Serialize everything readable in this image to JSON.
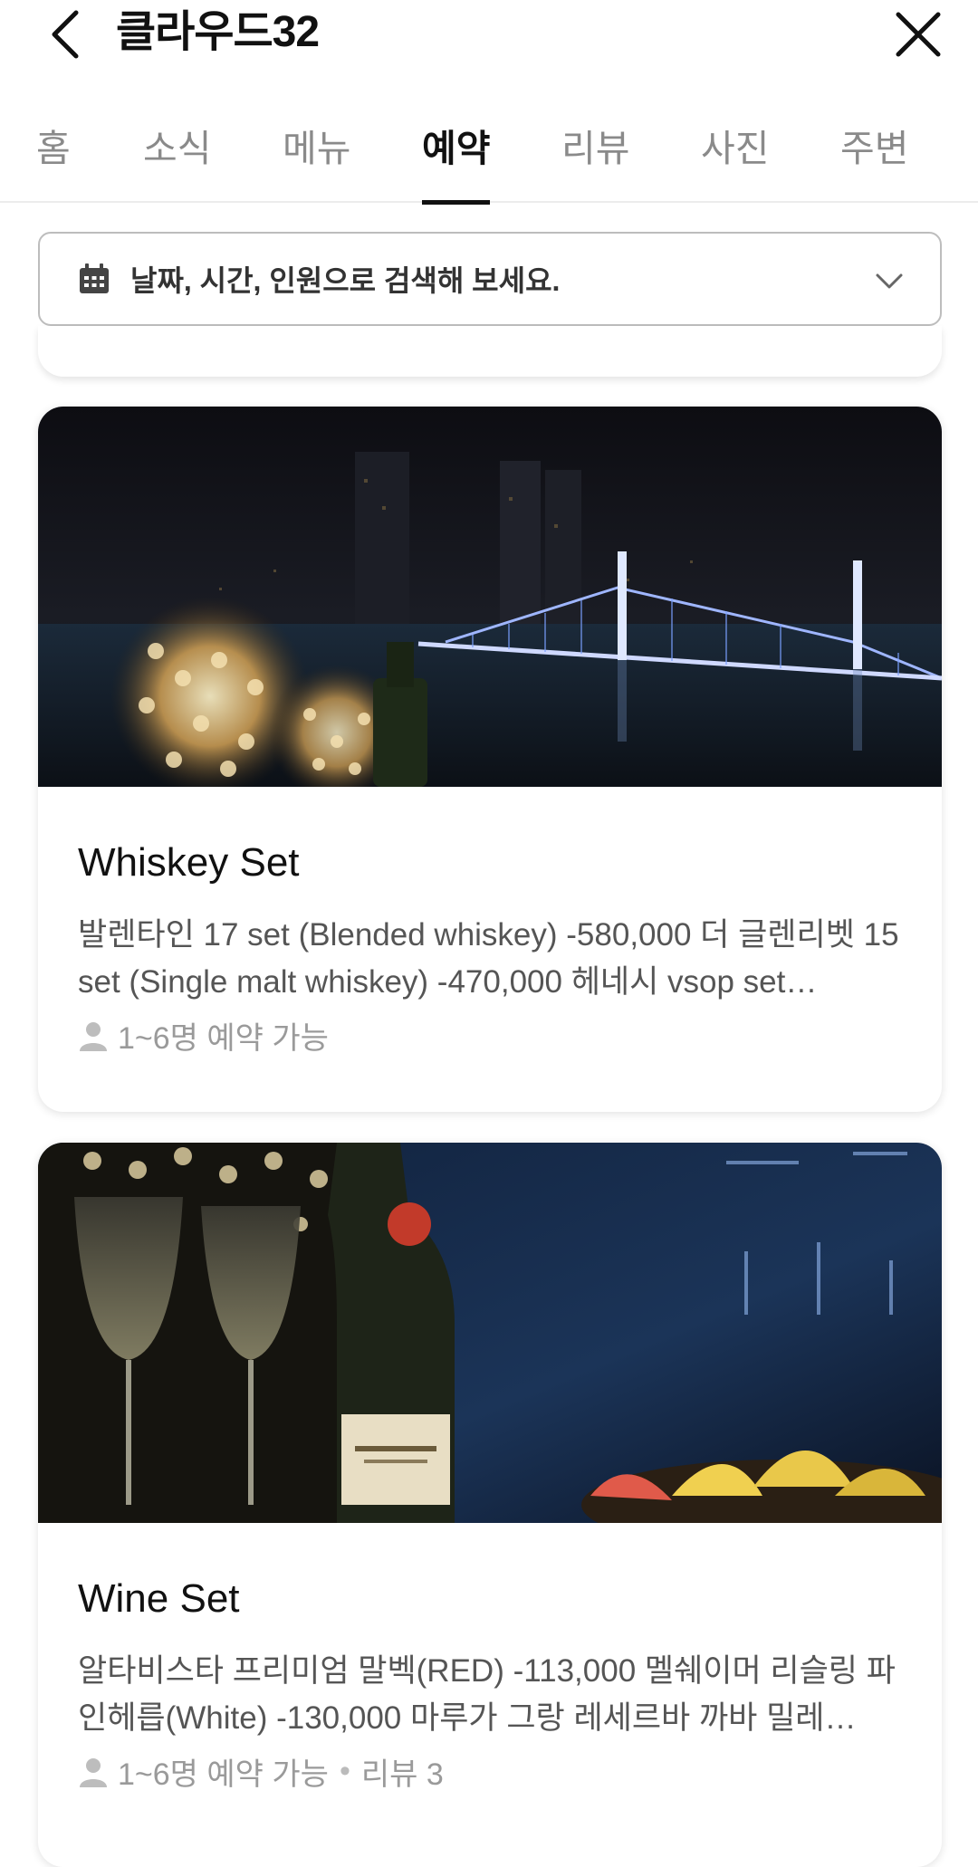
{
  "header": {
    "title": "클라우드32"
  },
  "tabs": [
    {
      "label": "홈",
      "active": false
    },
    {
      "label": "소식",
      "active": false
    },
    {
      "label": "메뉴",
      "active": false
    },
    {
      "label": "예약",
      "active": true
    },
    {
      "label": "리뷰",
      "active": false
    },
    {
      "label": "사진",
      "active": false
    },
    {
      "label": "주변",
      "active": false
    }
  ],
  "search": {
    "text": "날짜, 시간, 인원으로 검색해 보세요."
  },
  "cards": [
    {
      "title": "Whiskey Set",
      "description": "발렌타인 17 set (Blended whiskey) -580,000 더 글렌리벳 15 set (Single malt whiskey) -470,000 헤네시 vsop set…",
      "capacity": "1~6명 예약 가능",
      "reviews": ""
    },
    {
      "title": "Wine Set",
      "description": "알타비스타 프리미엄 말벡(RED) -113,000 멜쉐이머 리슬링 파인헤릅(White) -130,000 마루가 그랑 레세르바 까바 밀레…",
      "capacity": "1~6명 예약 가능",
      "reviews": "리뷰 3"
    }
  ],
  "colors": {
    "accent": "#111111",
    "muted": "#8a8a8a"
  }
}
